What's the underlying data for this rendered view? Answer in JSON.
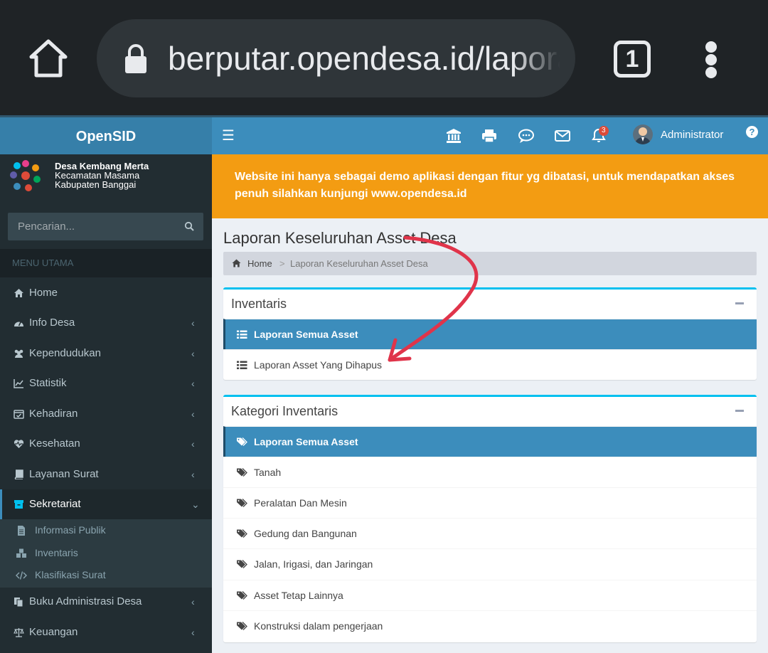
{
  "browser": {
    "url": "berputar.opendesa.id/laporan",
    "tab_count": "1"
  },
  "header": {
    "logo": "OpenSID",
    "user_name": "Administrator",
    "notification_count": "3",
    "help": "?"
  },
  "desa": {
    "name": "Desa Kembang Merta",
    "kecamatan": "Kecamatan Masama",
    "kabupaten": "Kabupaten Banggai"
  },
  "search": {
    "placeholder": "Pencarian..."
  },
  "menu": {
    "header": "MENU UTAMA",
    "items": [
      {
        "label": "Home",
        "icon": "home-icon"
      },
      {
        "label": "Info Desa",
        "icon": "dashboard-icon"
      },
      {
        "label": "Kependudukan",
        "icon": "users-icon"
      },
      {
        "label": "Statistik",
        "icon": "line-chart-icon"
      },
      {
        "label": "Kehadiran",
        "icon": "calendar-check-icon"
      },
      {
        "label": "Kesehatan",
        "icon": "heartbeat-icon"
      },
      {
        "label": "Layanan Surat",
        "icon": "book-icon"
      },
      {
        "label": "Sekretariat",
        "icon": "archive-icon"
      },
      {
        "label": "Buku Administrasi Desa",
        "icon": "copy-icon"
      },
      {
        "label": "Keuangan",
        "icon": "balance-scale-icon"
      }
    ],
    "submenu": [
      {
        "label": "Informasi Publik",
        "icon": "file-icon"
      },
      {
        "label": "Inventaris",
        "icon": "cubes-icon"
      },
      {
        "label": "Klasifikasi Surat",
        "icon": "code-icon"
      }
    ]
  },
  "callout": {
    "text": "Website ini hanya sebagai demo aplikasi dengan fitur yg dibatasi, untuk mendapatkan akses penuh silahkan kunjungi www.opendesa.id"
  },
  "page": {
    "title": "Laporan Keseluruhan Asset Desa",
    "breadcrumb_home": "Home",
    "breadcrumb_sep": ">",
    "breadcrumb_current": "Laporan Keseluruhan Asset Desa"
  },
  "inventaris_box": {
    "title": "Inventaris",
    "items": [
      "Laporan Semua Asset",
      "Laporan Asset Yang Dihapus"
    ]
  },
  "kategori_box": {
    "title": "Kategori Inventaris",
    "items": [
      "Laporan Semua Asset",
      "Tanah",
      "Peralatan Dan Mesin",
      "Gedung dan Bangunan",
      "Jalan, Irigasi, dan Jaringan",
      "Asset Tetap Lainnya",
      "Konstruksi dalam pengerjaan"
    ]
  },
  "colors": {
    "primary": "#3c8dbc",
    "sidebar": "#222d32",
    "warning": "#f39c12",
    "annotation": "#e0344a"
  }
}
